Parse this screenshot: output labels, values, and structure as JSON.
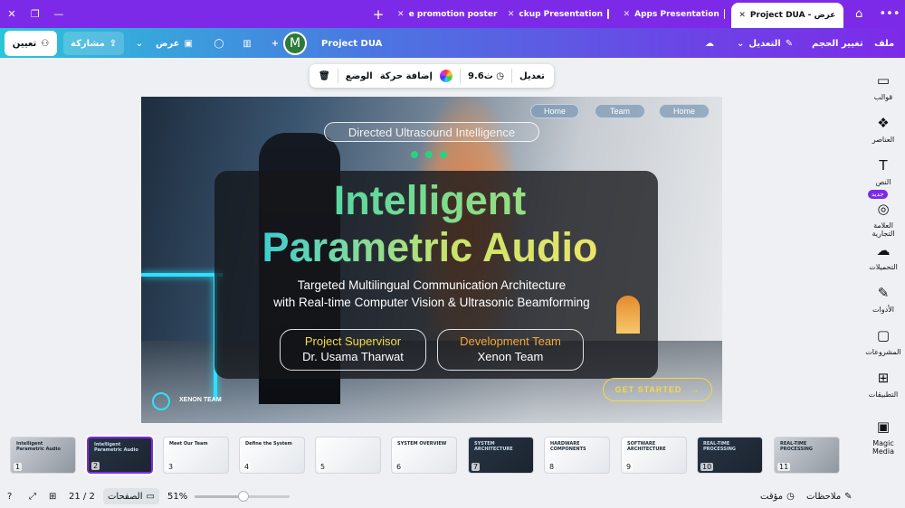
{
  "tabs": [
    {
      "label": "e promotion poster"
    },
    {
      "label": "ckup Presentation"
    },
    {
      "label": "Apps Presentation"
    },
    {
      "label": "Project DUA - عرض"
    }
  ],
  "header": {
    "menu_file": "ملف",
    "resize": "تغيير الحجم",
    "edit": "التعديل",
    "project_name": "Project DUA",
    "avatar_letter": "M",
    "present": "عرض",
    "share": "مشاركة",
    "assign": "تعيين"
  },
  "floating_toolbar": {
    "edit": "تعديل",
    "duration": "9.6ث",
    "add_animation": "إضافة حركة",
    "position": "الوضع"
  },
  "slide": {
    "nav": [
      "Home",
      "Team",
      "Home"
    ],
    "subtitle": "Directed Ultrasound Intelligence",
    "title_line1": "Intelligent",
    "title_line2": "Parametric Audio",
    "desc_line1": "Targeted Multilingual Communication Architecture",
    "desc_line2": "with Real-time Computer Vision & Ultrasonic Beamforming",
    "supervisor_label": "Project Supervisor",
    "supervisor_name": "Dr. Usama Tharwat",
    "team_label": "Development Team",
    "team_name": "Xenon Team",
    "logo_text": "XENON TEAM",
    "cta": "GET STARTED"
  },
  "sidebar": {
    "items": [
      {
        "label": "قوالب",
        "icon": "templates-icon",
        "glyph": "▭"
      },
      {
        "label": "العناصر",
        "icon": "elements-icon",
        "glyph": "❖"
      },
      {
        "label": "النص",
        "icon": "text-icon",
        "glyph": "T"
      },
      {
        "label": "العلامة التجارية",
        "icon": "brand-icon",
        "glyph": "◎"
      },
      {
        "label": "التحميلات",
        "icon": "uploads-icon",
        "glyph": "☁"
      },
      {
        "label": "الأدوات",
        "icon": "tools-icon",
        "glyph": "✎"
      },
      {
        "label": "المشروعات",
        "icon": "projects-icon",
        "glyph": "▢"
      },
      {
        "label": "التطبيقات",
        "icon": "apps-icon",
        "glyph": "⊞"
      },
      {
        "label": "Magic Media",
        "icon": "magic-media-icon",
        "glyph": "▣"
      }
    ],
    "new_badge": "جديد"
  },
  "thumbnails": [
    {
      "num": "1",
      "title": "Intelligent Parametric Audio",
      "style": "gray"
    },
    {
      "num": "2",
      "title": "Intelligent Parametric Audio",
      "style": "dark"
    },
    {
      "num": "3",
      "title": "Meet Our Team",
      "style": "light"
    },
    {
      "num": "4",
      "title": "Define the System",
      "style": "light"
    },
    {
      "num": "5",
      "title": "",
      "style": "light"
    },
    {
      "num": "6",
      "title": "SYSTEM OVERVIEW",
      "style": "light"
    },
    {
      "num": "7",
      "title": "SYSTEM ARCHITECTURE",
      "style": "dark"
    },
    {
      "num": "8",
      "title": "HARDWARE COMPONENTS",
      "style": "light"
    },
    {
      "num": "9",
      "title": "SOFTWARE ARCHITECTURE",
      "style": "light"
    },
    {
      "num": "10",
      "title": "REAL-TIME PROCESSING",
      "style": "dark"
    },
    {
      "num": "11",
      "title": "REAL-TIME PROCESSING",
      "style": "gray"
    }
  ],
  "status": {
    "notes": "ملاحظات",
    "timer": "مؤقت",
    "zoom": "51%",
    "zoom_fraction": 0.51,
    "pages": "الصفحات",
    "page_counter": "21 / 2"
  },
  "colors": {
    "accent": "#7d2ae8",
    "brand_gradient_start": "#2ac5d9",
    "cta": "#f2d94a"
  }
}
